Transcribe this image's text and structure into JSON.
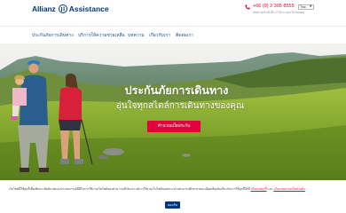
{
  "header": {
    "logo_part1": "Allianz",
    "logo_part2": "Assistance",
    "phone": "+66 (0) 2 305 8555",
    "phone_hours": "จันทร์-ศุกร์ 08:30-17:30 น. (ยกเว้นวันหยุด)",
    "language": "ไทย"
  },
  "nav": {
    "items": [
      {
        "label": "ประกันภัยการเดินทาง"
      },
      {
        "label": "บริการให้ความช่วยเหลือ"
      },
      {
        "label": "บทความ"
      },
      {
        "label": "เกี่ยวกับเรา"
      },
      {
        "label": "ติดต่อเรา"
      }
    ]
  },
  "hero": {
    "title": "ประกันภัยการเดินทาง",
    "subtitle": "อุ่นใจทุกสไตล์การเดินทางของคุณ",
    "cta_label": "คำนวณเบี้ยประกัน"
  },
  "cookie": {
    "text": "เว็บไซต์นี้ใช้คุกกี้เพื่อเพิ่มประสิทธิภาพและประสบการณ์ที่ดีในการใช้งานเว็บไซต์ของท่าน รวมถึงวิเคราะห์การใช้งานเว็บไซต์ของท่าน ท่านสามารถศึกษารายละเอียดเพิ่มเติมเกี่ยวกับการใช้คุกกี้ได้ที่ ",
    "policy_link": "นโยบายคุกกี้",
    "and_text": " และ ",
    "privacy_link": "นโยบายความเป็นส่วนตัว",
    "accept_label": "ยอมรับ"
  },
  "colors": {
    "brand_blue": "#003781",
    "accent_red": "#e4003a",
    "nav_text": "#1c4d8c"
  },
  "icons": {
    "phone": "phone-icon",
    "language_caret": "chevron-down-icon"
  }
}
